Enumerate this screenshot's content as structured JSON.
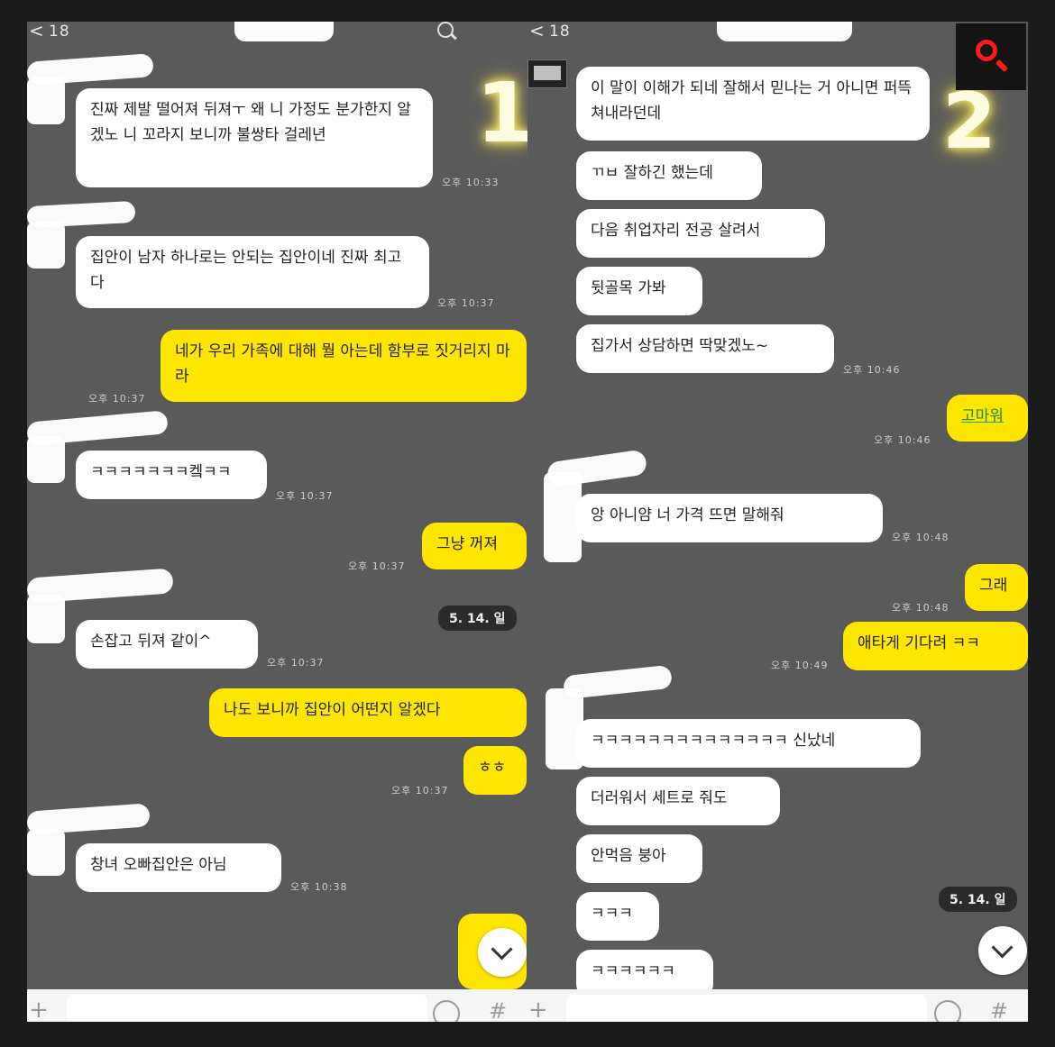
{
  "left_panel": {
    "back_label": "<",
    "count": "18",
    "overlay_number": "1",
    "messages": [
      {
        "text": "진짜 제발 떨어져 뒤져ㅜ 왜 니 가정도 분가한지 알겠노 니 꼬라지 보니까 불쌍타 걸레년",
        "time": "오후 10:33"
      },
      {
        "text": "집안이 남자 하나로는 안되는 집안이네 진짜 최고다",
        "time": "오후 10:37"
      },
      {
        "text": "네가 우리 가족에 대해 뭘 아는데 함부로 짓거리지 마라",
        "time": "오후 10:37"
      },
      {
        "text": "ㅋㅋㅋㅋㅋㅋㅋ켘ㅋㅋ",
        "time": "오후 10:37"
      },
      {
        "text": "그냥 꺼져",
        "time": "오후 10:37"
      },
      {
        "text": "손잡고 뒤져 같이^",
        "time": "오후 10:37"
      },
      {
        "text": "나도 보니까 집안이 어떤지 알겠다",
        "time": ""
      },
      {
        "text": "ㅎㅎ",
        "time": "오후 10:37"
      },
      {
        "text": "창녀 오빠집안은 아님",
        "time": "오후 10:38"
      }
    ],
    "date_chip": "5. 14. 일"
  },
  "right_panel": {
    "back_label": "<",
    "count": "18",
    "overlay_number": "2",
    "messages": [
      {
        "text": "이 말이 이해가 되네 잘해서 믿나는 거 아니면 퍼뜩 쳐내라던데",
        "time": ""
      },
      {
        "text": "ㄲㅂ 잘하긴 했는데",
        "time": ""
      },
      {
        "text": "다음 취업자리 전공 살려서",
        "time": ""
      },
      {
        "text": "뒷골목 가봐",
        "time": ""
      },
      {
        "text": "집가서 상담하면 딱맞겠노~",
        "time": "오후 10:46"
      },
      {
        "text": "고마워",
        "time": "오후 10:46"
      },
      {
        "text": "앙 아니얌 너 가격 뜨면 말해줘",
        "time": "오후 10:48"
      },
      {
        "text": "그래",
        "time": "오후 10:48"
      },
      {
        "text": "애타게 기다려 ㅋㅋ",
        "time": "오후 10:49"
      },
      {
        "text": "ㅋㅋㅋㅋㅋㅋㅋㅋㅋㅋㅋㅋㅋㅋ 신났네",
        "time": ""
      },
      {
        "text": "더러워서 세트로 줘도",
        "time": ""
      },
      {
        "text": "안먹음 붕아",
        "time": ""
      },
      {
        "text": "ㅋㅋㅋ",
        "time": ""
      },
      {
        "text": "ㅋㅋㅋㅋㅋㅋ",
        "time": ""
      }
    ],
    "date_chip": "5. 14. 일"
  },
  "colors": {
    "my_bubble": "#ffe600",
    "their_bubble": "#ffffff",
    "background": "#5a5a5a",
    "zoom_icon": "#ff1a1a"
  },
  "icons": [
    "search-icon",
    "menu-icon",
    "chevron-down-icon",
    "emoji-icon",
    "hash-icon",
    "plus-icon",
    "zoom-search-icon"
  ]
}
